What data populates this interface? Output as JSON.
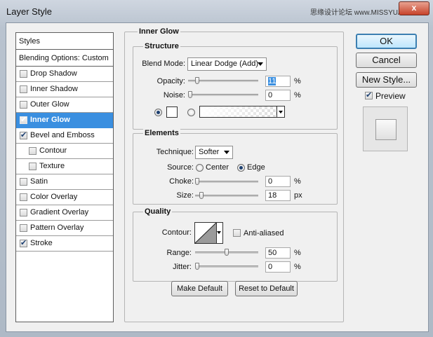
{
  "window": {
    "title": "Layer Style",
    "watermark": "思缘设计论坛 www.MISSYUAN.COM",
    "close_glyph": "x"
  },
  "styles_list": {
    "header": "Styles",
    "blending_options": "Blending Options: Custom",
    "items": [
      {
        "label": "Drop Shadow",
        "checked": false,
        "selected": false
      },
      {
        "label": "Inner Shadow",
        "checked": false,
        "selected": false
      },
      {
        "label": "Outer Glow",
        "checked": false,
        "selected": false
      },
      {
        "label": "Inner Glow",
        "checked": true,
        "selected": true
      },
      {
        "label": "Bevel and Emboss",
        "checked": true,
        "selected": false
      },
      {
        "label": "Contour",
        "checked": false,
        "selected": false
      },
      {
        "label": "Texture",
        "checked": false,
        "selected": false
      },
      {
        "label": "Satin",
        "checked": false,
        "selected": false
      },
      {
        "label": "Color Overlay",
        "checked": false,
        "selected": false
      },
      {
        "label": "Gradient Overlay",
        "checked": false,
        "selected": false
      },
      {
        "label": "Pattern Overlay",
        "checked": false,
        "selected": false
      },
      {
        "label": "Stroke",
        "checked": true,
        "selected": false
      }
    ]
  },
  "inner_glow": {
    "title": "Inner Glow",
    "structure": {
      "title": "Structure",
      "blend_mode_label": "Blend Mode:",
      "blend_mode_value": "Linear Dodge (Add)",
      "opacity_label": "Opacity:",
      "opacity_value": "11",
      "opacity_unit": "%",
      "opacity_level": 11,
      "noise_label": "Noise:",
      "noise_value": "0",
      "noise_unit": "%",
      "noise_level": 0,
      "glow_color": "#ffffff"
    },
    "elements": {
      "title": "Elements",
      "technique_label": "Technique:",
      "technique_value": "Softer",
      "source_label": "Source:",
      "source_center": "Center",
      "source_edge": "Edge",
      "choke_label": "Choke:",
      "choke_value": "0",
      "choke_unit": "%",
      "choke_level": 0,
      "size_label": "Size:",
      "size_value": "18",
      "size_unit": "px",
      "size_level": 7
    },
    "quality": {
      "title": "Quality",
      "contour_label": "Contour:",
      "antialiased_label": "Anti-aliased",
      "range_label": "Range:",
      "range_value": "50",
      "range_unit": "%",
      "range_level": 50,
      "jitter_label": "Jitter:",
      "jitter_value": "0",
      "jitter_unit": "%",
      "jitter_level": 0
    },
    "make_default": "Make Default",
    "reset_default": "Reset to Default"
  },
  "buttons": {
    "ok": "OK",
    "cancel": "Cancel",
    "new_style": "New Style...",
    "preview_label": "Preview",
    "preview_checked": true
  },
  "colors": {
    "accent": "#3a8fe0"
  }
}
